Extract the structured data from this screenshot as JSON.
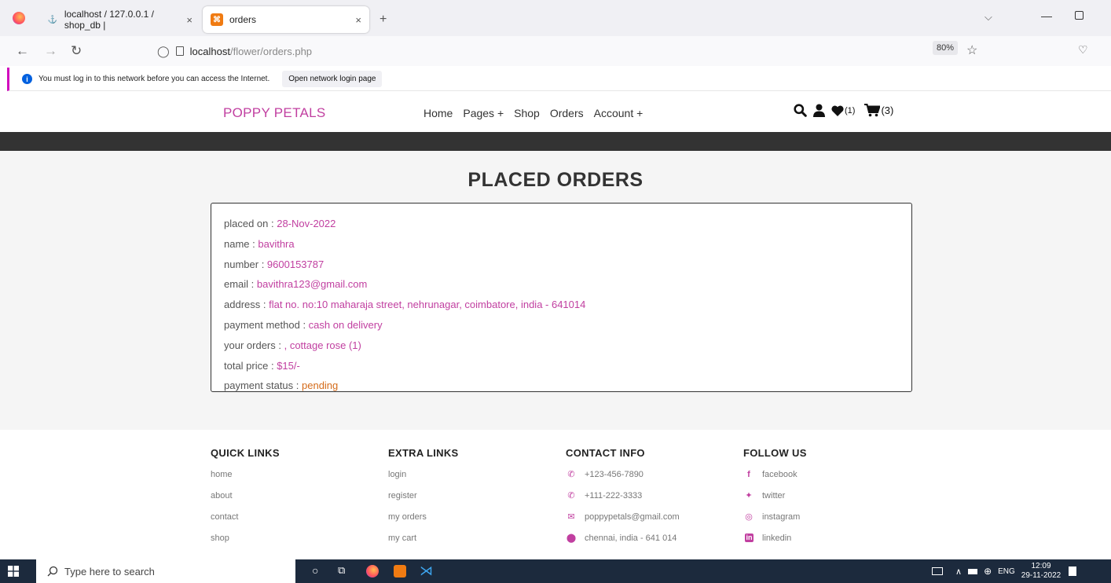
{
  "browser": {
    "tabs": [
      {
        "title": "localhost / 127.0.0.1 / shop_db |",
        "close": "×"
      },
      {
        "title": "orders",
        "close": "×"
      }
    ],
    "new_tab": "+",
    "url_host": "localhost",
    "url_path": "/flower/orders.php",
    "zoom": "80%",
    "notification": {
      "text": "You must log in to this network before you can access the Internet.",
      "button": "Open network login page"
    }
  },
  "site": {
    "logo": "POPPY PETALS",
    "nav": [
      "Home",
      "Pages +",
      "Shop",
      "Orders",
      "Account +"
    ],
    "wishlist_count": "(1)",
    "cart_count": "(3)"
  },
  "page_title": "PLACED ORDERS",
  "order": {
    "rows": [
      {
        "label": "placed on : ",
        "value": "28-Nov-2022"
      },
      {
        "label": "name : ",
        "value": "bavithra"
      },
      {
        "label": "number : ",
        "value": "9600153787"
      },
      {
        "label": "email : ",
        "value": "bavithra123@gmail.com"
      },
      {
        "label": "address : ",
        "value": "flat no. no:10 maharaja street, nehrunagar, coimbatore, india - 641014"
      },
      {
        "label": "payment method : ",
        "value": "cash on delivery"
      },
      {
        "label": "your orders : ",
        "value": ", cottage rose (1)"
      },
      {
        "label": "total price : ",
        "value": "$15/-"
      },
      {
        "label": "payment status : ",
        "value": "pending"
      }
    ],
    "status_color": "#d46b1a"
  },
  "footer": {
    "quick_links": {
      "title": "QUICK LINKS",
      "items": [
        "home",
        "about",
        "contact",
        "shop"
      ]
    },
    "extra_links": {
      "title": "EXTRA LINKS",
      "items": [
        "login",
        "register",
        "my orders",
        "my cart"
      ]
    },
    "contact_info": {
      "title": "CONTACT INFO",
      "items": [
        "+123-456-7890",
        "+111-222-3333",
        "poppypetals@gmail.com",
        "chennai, india - 641 014"
      ]
    },
    "follow_us": {
      "title": "FOLLOW US",
      "items": [
        "facebook",
        "twitter",
        "instagram",
        "linkedin"
      ]
    }
  },
  "taskbar": {
    "search_placeholder": "Type here to search",
    "lang": "ENG",
    "time": "12:09",
    "date": "29-11-2022"
  },
  "colors": {
    "accent": "#c13fa0",
    "dark_bar": "#333333",
    "taskbar": "#1c2a3d"
  }
}
